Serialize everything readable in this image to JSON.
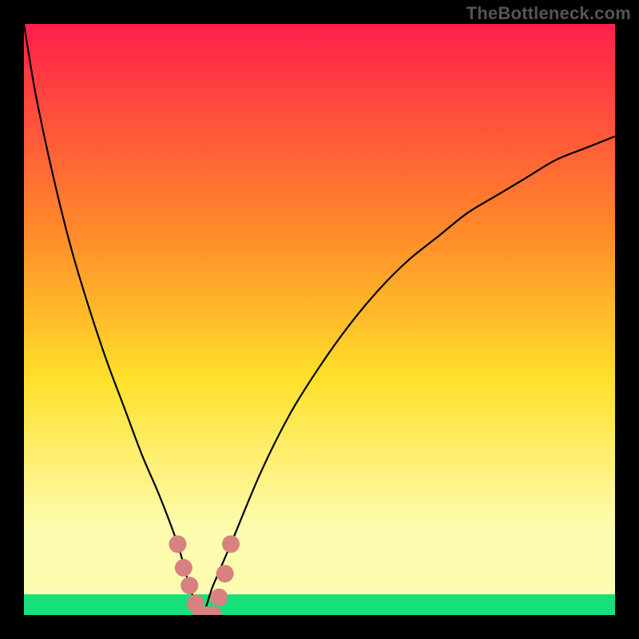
{
  "watermark": "TheBottleneck.com",
  "colors": {
    "gradient_top": "#ff1f4b",
    "gradient_mid_upper": "#ff8a2a",
    "gradient_mid": "#ffe02a",
    "gradient_lower": "#fdfcae",
    "gradient_bottom": "#17e07a",
    "curve": "#000000",
    "marker_fill": "#d98080",
    "marker_stroke": "#b85a5a"
  },
  "chart_data": {
    "type": "line",
    "title": "",
    "xlabel": "",
    "ylabel": "",
    "xlim": [
      0,
      100
    ],
    "ylim": [
      0,
      100
    ],
    "x_min_point": 30,
    "series": [
      {
        "name": "bottleneck-curve",
        "x": [
          0,
          2,
          5,
          8,
          11,
          14,
          17,
          20,
          23,
          26,
          28,
          30,
          32,
          35,
          40,
          45,
          50,
          55,
          60,
          65,
          70,
          75,
          80,
          85,
          90,
          95,
          100
        ],
        "y": [
          100,
          88,
          74,
          62,
          52,
          43,
          35,
          27,
          20,
          12,
          5,
          0,
          5,
          12,
          24,
          34,
          42,
          49,
          55,
          60,
          64,
          68,
          71,
          74,
          77,
          79,
          81
        ]
      }
    ],
    "markers": {
      "name": "highlight-cluster",
      "points": [
        {
          "x": 26,
          "y": 12
        },
        {
          "x": 27,
          "y": 8
        },
        {
          "x": 28,
          "y": 5
        },
        {
          "x": 29,
          "y": 2
        },
        {
          "x": 30,
          "y": 0
        },
        {
          "x": 31,
          "y": 0
        },
        {
          "x": 32,
          "y": 0
        },
        {
          "x": 33,
          "y": 3
        },
        {
          "x": 34,
          "y": 7
        },
        {
          "x": 35,
          "y": 12
        }
      ]
    }
  }
}
